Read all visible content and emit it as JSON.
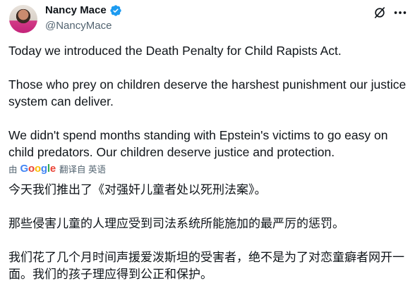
{
  "author": {
    "name": "Nancy Mace",
    "handle": "@NancyMace",
    "verified_color": "#1d9bf0"
  },
  "icons": {
    "grok": "grok-icon",
    "more": "more-icon",
    "verified": "verified-badge-icon"
  },
  "tweet": {
    "p1": "Today we introduced the Death Penalty for Child Rapists Act.",
    "p2": "Those who prey on children deserve the harshest punishment our justice system can deliver.",
    "p3": "We didn't spend months standing with Epstein's victims to go easy on child predators. Our children deserve justice and protection."
  },
  "translation": {
    "by": "由",
    "google": [
      "G",
      "o",
      "o",
      "g",
      "l",
      "e"
    ],
    "label": "翻译自 英语",
    "p1": "今天我们推出了《对强奸儿童者处以死刑法案》。",
    "p2": "那些侵害儿童的人理应受到司法系统所能施加的最严厉的惩罚。",
    "p3": "我们花了几个月时间声援爱泼斯坦的受害者，绝不是为了对恋童癖者网开一面。我们的孩子理应得到公正和保护。"
  }
}
